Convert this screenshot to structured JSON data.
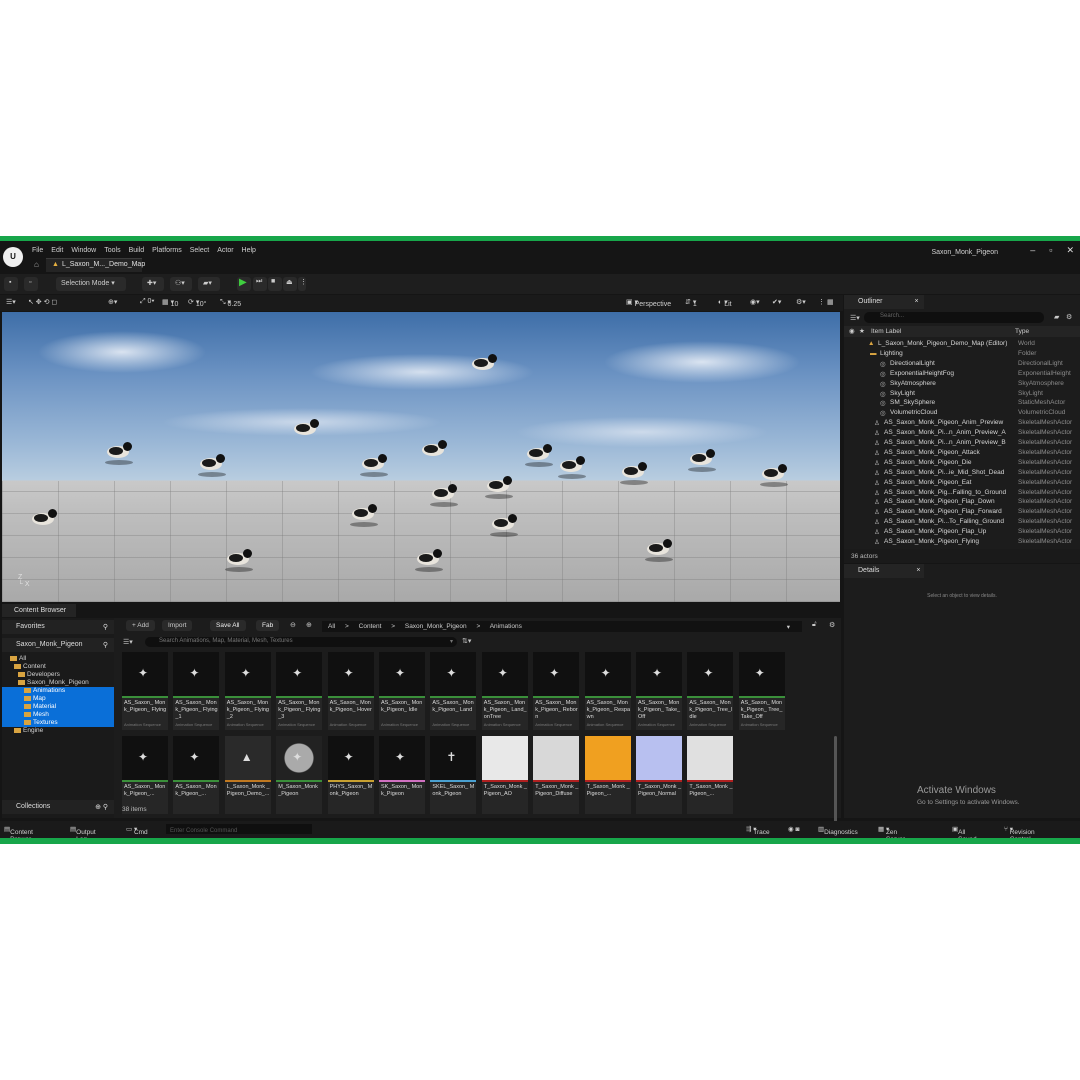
{
  "app": {
    "window_title": "Saxon_Monk_Pigeon",
    "menu": [
      "File",
      "Edit",
      "Window",
      "Tools",
      "Build",
      "Platforms",
      "Select",
      "Actor",
      "Help"
    ],
    "level_tab": "L_Saxon_M..._Demo_Map",
    "window_controls": [
      "–",
      "▫",
      "✕"
    ]
  },
  "toolbar": {
    "mode": "Selection Mode",
    "play_icon": "play-icon"
  },
  "viewport": {
    "perspective": "Perspective",
    "lit": "Lit",
    "grid_snap": "10",
    "rot_snap": "10°",
    "scale_snap": "0.25",
    "speed": "1"
  },
  "outliner": {
    "tab": "Outliner",
    "search_placeholder": "Search...",
    "col_label": "Item Label",
    "col_type": "Type",
    "rows": [
      {
        "label": "L_Saxon_Monk_Pigeon_Demo_Map (Editor)",
        "type": "World"
      },
      {
        "label": "Lighting",
        "type": "Folder"
      },
      {
        "label": "DirectionalLight",
        "type": "DirectionalLight"
      },
      {
        "label": "ExponentialHeightFog",
        "type": "ExponentialHeight"
      },
      {
        "label": "SkyAtmosphere",
        "type": "SkyAtmosphere"
      },
      {
        "label": "SkyLight",
        "type": "SkyLight"
      },
      {
        "label": "SM_SkySphere",
        "type": "StaticMeshActor"
      },
      {
        "label": "VolumetricCloud",
        "type": "VolumetricCloud"
      },
      {
        "label": "AS_Saxon_Monk_Pigeon_Anim_Preview",
        "type": "SkeletalMeshActor"
      },
      {
        "label": "AS_Saxon_Monk_Pi...n_Anim_Preview_A",
        "type": "SkeletalMeshActor"
      },
      {
        "label": "AS_Saxon_Monk_Pi...n_Anim_Preview_B",
        "type": "SkeletalMeshActor"
      },
      {
        "label": "AS_Saxon_Monk_Pigeon_Attack",
        "type": "SkeletalMeshActor"
      },
      {
        "label": "AS_Saxon_Monk_Pigeon_Die",
        "type": "SkeletalMeshActor"
      },
      {
        "label": "AS_Saxon_Monk_Pi...ie_Mid_Shot_Dead",
        "type": "SkeletalMeshActor"
      },
      {
        "label": "AS_Saxon_Monk_Pigeon_Eat",
        "type": "SkeletalMeshActor"
      },
      {
        "label": "AS_Saxon_Monk_Pig...Falling_to_Ground",
        "type": "SkeletalMeshActor"
      },
      {
        "label": "AS_Saxon_Monk_Pigeon_Flap_Down",
        "type": "SkeletalMeshActor"
      },
      {
        "label": "AS_Saxon_Monk_Pigeon_Flap_Forward",
        "type": "SkeletalMeshActor"
      },
      {
        "label": "AS_Saxon_Monk_Pi...To_Falling_Ground",
        "type": "SkeletalMeshActor"
      },
      {
        "label": "AS_Saxon_Monk_Pigeon_Flap_Up",
        "type": "SkeletalMeshActor"
      },
      {
        "label": "AS_Saxon_Monk_Pigeon_Flying",
        "type": "SkeletalMeshActor"
      }
    ],
    "actor_count": "36 actors"
  },
  "details": {
    "tab": "Details",
    "empty_text": "Select an object to view details."
  },
  "activate_windows": {
    "title": "Activate Windows",
    "subtitle": "Go to Settings to activate Windows."
  },
  "content_browser": {
    "tab": "Content Browser",
    "add": "+ Add",
    "import": "Import",
    "save_all": "Save All",
    "fab": "Fab",
    "favorites": "Favorites",
    "project": "Saxon_Monk_Pigeon",
    "collections": "Collections",
    "tree": [
      "All",
      "Content",
      "Developers",
      "Saxon_Monk_Pigeon",
      "Animations",
      "Map",
      "Material",
      "Mesh",
      "Textures",
      "Engine"
    ],
    "breadcrumb": [
      "All",
      ">",
      "Content",
      ">",
      "Saxon_Monk_Pigeon",
      ">",
      "Animations"
    ],
    "search_placeholder": "Search Animations, Map, Material, Mesh, Textures",
    "items_count": "38 items",
    "assets": [
      {
        "name": "AS_Saxon_ Monk_Pigeon_ Flying",
        "sub": "Animation Sequence",
        "color": "#3a8f3a"
      },
      {
        "name": "AS_Saxon_ Monk_Pigeon_ Flying_1",
        "sub": "Animation Sequence",
        "color": "#3a8f3a"
      },
      {
        "name": "AS_Saxon_ Monk_Pigeon_ Flying_2",
        "sub": "Animation Sequence",
        "color": "#3a8f3a"
      },
      {
        "name": "AS_Saxon_ Monk_Pigeon_ Flying_3",
        "sub": "Animation Sequence",
        "color": "#3a8f3a"
      },
      {
        "name": "AS_Saxon_ Monk_Pigeon_ Hover",
        "sub": "Animation Sequence",
        "color": "#3a8f3a"
      },
      {
        "name": "AS_Saxon_ Monk_Pigeon_ Idle",
        "sub": "Animation Sequence",
        "color": "#3a8f3a"
      },
      {
        "name": "AS_Saxon_ Monk_Pigeon_ Land",
        "sub": "Animation Sequence",
        "color": "#3a8f3a"
      },
      {
        "name": "AS_Saxon_ Monk_Pigeon_ Land_onTree",
        "sub": "Animation Sequence",
        "color": "#3a8f3a"
      },
      {
        "name": "AS_Saxon_ Monk_Pigeon_ Reborn",
        "sub": "Animation Sequence",
        "color": "#3a8f3a"
      },
      {
        "name": "AS_Saxon_ Monk_Pigeon_ Respawn",
        "sub": "Animation Sequence",
        "color": "#3a8f3a"
      },
      {
        "name": "AS_Saxon_ Monk_Pigeon_ Take_Off",
        "sub": "Animation Sequence",
        "color": "#3a8f3a"
      },
      {
        "name": "AS_Saxon_ Monk_Pigeon_ Tree_Idle",
        "sub": "Animation Sequence",
        "color": "#3a8f3a"
      },
      {
        "name": "AS_Saxon_ Monk_Pigeon_ Tree_Take_Off",
        "sub": "Animation Sequence",
        "color": "#3a8f3a"
      },
      {
        "name": "AS_Saxon_ Monk_Pigeon_...",
        "sub": "",
        "color": "#3a8f3a"
      },
      {
        "name": "AS_Saxon_ Monk_Pigeon_...",
        "sub": "",
        "color": "#3a8f3a"
      },
      {
        "name": "L_Saxon_Monk _Pigeon_Demo_...",
        "sub": "",
        "color": "#c07820"
      },
      {
        "name": "M_Saxon_Monk _Pigeon",
        "sub": "",
        "color": "#3a8f3a"
      },
      {
        "name": "PHYS_Saxon_ Monk_Pigeon",
        "sub": "",
        "color": "#c8a030"
      },
      {
        "name": "SK_Saxon_ Monk_Pigeon",
        "sub": "",
        "color": "#d070c0"
      },
      {
        "name": "SKEL_Saxon_ Monk_Pigeon",
        "sub": "",
        "color": "#4aa0d0"
      },
      {
        "name": "T_Saxon_Monk _Pigeon_AO",
        "sub": "",
        "color": "#b02020"
      },
      {
        "name": "T_Saxon_Monk _Pigeon_Diffuse",
        "sub": "",
        "color": "#b02020"
      },
      {
        "name": "T_Saxon_Monk _Pigeon_...",
        "sub": "",
        "color": "#b02020"
      },
      {
        "name": "T_Saxon_Monk _Pigeon_Normal",
        "sub": "",
        "color": "#b02020"
      },
      {
        "name": "T_Saxon_Monk _Pigeon_...",
        "sub": "",
        "color": "#b02020"
      }
    ]
  },
  "statusbar": {
    "content_drawer": "Content Drawer",
    "output_log": "Output Log",
    "cmd": "Cmd",
    "console_placeholder": "Enter Console Command",
    "trace": "Trace",
    "diagnostics": "Diagnostics",
    "zen_server": "Zen Server",
    "all_saved": "All Saved",
    "revision_control": "Revision Control"
  }
}
